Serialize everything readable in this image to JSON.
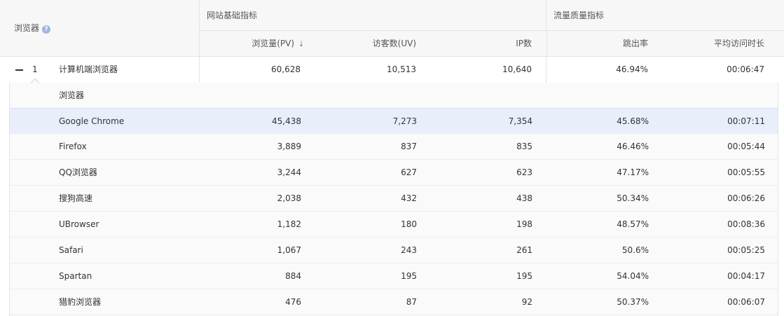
{
  "header": {
    "browser_label": "浏览器",
    "help_icon": "?",
    "group_basic": "网站基础指标",
    "group_quality": "流量质量指标",
    "columns": [
      "浏览量(PV)",
      "访客数(UV)",
      "IP数",
      "跳出率",
      "平均访问时长"
    ],
    "sort_icon": "down-arrow-icon"
  },
  "parent_row": {
    "index": "1",
    "name": "计算机端浏览器",
    "pv": "60,628",
    "uv": "10,513",
    "ip": "10,640",
    "bounce": "46.94%",
    "duration": "00:06:47"
  },
  "sub_table": {
    "header": "浏览器",
    "rows": [
      {
        "name": "Google Chrome",
        "pv": "45,438",
        "uv": "7,273",
        "ip": "7,354",
        "bounce": "45.68%",
        "duration": "00:07:11"
      },
      {
        "name": "Firefox",
        "pv": "3,889",
        "uv": "837",
        "ip": "835",
        "bounce": "46.46%",
        "duration": "00:05:44"
      },
      {
        "name": "QQ浏览器",
        "pv": "3,244",
        "uv": "627",
        "ip": "623",
        "bounce": "47.17%",
        "duration": "00:05:55"
      },
      {
        "name": "搜狗高速",
        "pv": "2,038",
        "uv": "432",
        "ip": "438",
        "bounce": "50.34%",
        "duration": "00:06:26"
      },
      {
        "name": "UBrowser",
        "pv": "1,182",
        "uv": "180",
        "ip": "198",
        "bounce": "48.57%",
        "duration": "00:08:36"
      },
      {
        "name": "Safari",
        "pv": "1,067",
        "uv": "243",
        "ip": "261",
        "bounce": "50.6%",
        "duration": "00:05:25"
      },
      {
        "name": "Spartan",
        "pv": "884",
        "uv": "195",
        "ip": "195",
        "bounce": "54.04%",
        "duration": "00:04:17"
      },
      {
        "name": "猎豹浏览器",
        "pv": "476",
        "uv": "87",
        "ip": "92",
        "bounce": "50.37%",
        "duration": "00:06:07"
      }
    ]
  },
  "colors": {
    "highlight_row": "#e8eefa",
    "help_icon": "#9bb7e0",
    "border": "#e3e3e3"
  }
}
